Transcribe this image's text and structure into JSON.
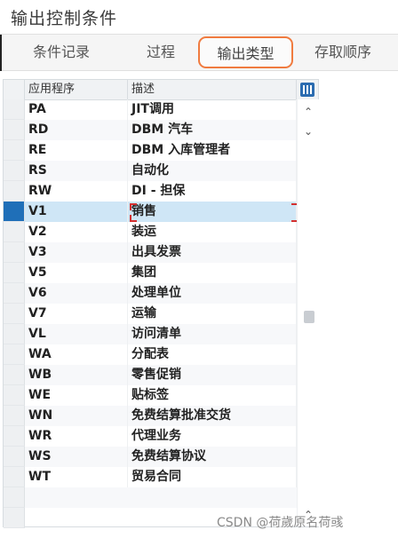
{
  "title": "输出控制条件",
  "tabs": [
    {
      "label": "条件记录",
      "active": false
    },
    {
      "label": "过程",
      "active": false
    },
    {
      "label": "输出类型",
      "active": true
    },
    {
      "label": "存取顺序",
      "active": false
    }
  ],
  "grid": {
    "columns": [
      "应用程序",
      "描述"
    ],
    "rows": [
      {
        "app": "PA",
        "desc": "JIT调用"
      },
      {
        "app": "RD",
        "desc": "DBM 汽车"
      },
      {
        "app": "RE",
        "desc": "DBM 入库管理者"
      },
      {
        "app": "RS",
        "desc": "自动化"
      },
      {
        "app": "RW",
        "desc": "DI - 担保"
      },
      {
        "app": "V1",
        "desc": "销售"
      },
      {
        "app": "V2",
        "desc": "装运"
      },
      {
        "app": "V3",
        "desc": "出具发票"
      },
      {
        "app": "V5",
        "desc": "集团"
      },
      {
        "app": "V6",
        "desc": "处理单位"
      },
      {
        "app": "V7",
        "desc": "运输"
      },
      {
        "app": "VL",
        "desc": "访问清单"
      },
      {
        "app": "WA",
        "desc": "分配表"
      },
      {
        "app": "WB",
        "desc": "零售促销"
      },
      {
        "app": "WE",
        "desc": "贴标签"
      },
      {
        "app": "WN",
        "desc": "免费结算批准交货"
      },
      {
        "app": "WR",
        "desc": "代理业务"
      },
      {
        "app": "WS",
        "desc": "免费结算协议"
      },
      {
        "app": "WT",
        "desc": "贸易合同"
      }
    ],
    "selected_app": "V1",
    "icons": {
      "settings": "table-settings-icon",
      "scroll_up": "chevron-up-icon",
      "scroll_down": "chevron-down-icon"
    }
  },
  "watermark": "CSDN @荷歲原名荷彧",
  "colors": {
    "active_tab_border": "#f07b3f",
    "selected_row": "#cfe6f6",
    "selected_marker": "#1f6fb8",
    "focus_marker": "#d32f2f"
  }
}
